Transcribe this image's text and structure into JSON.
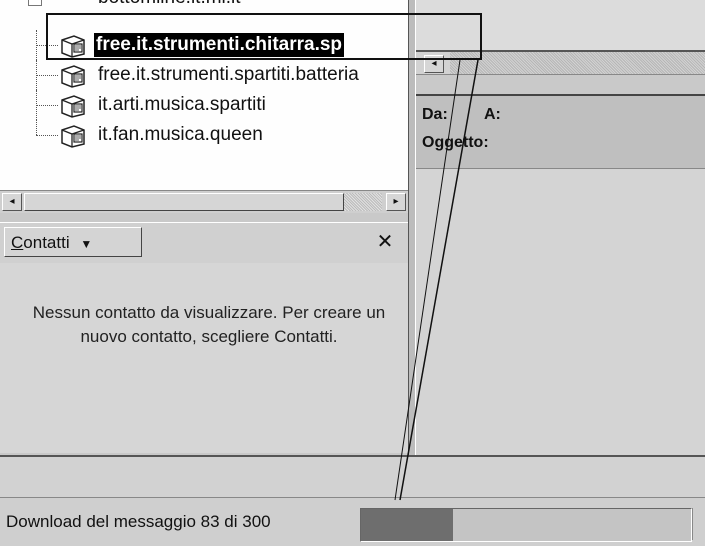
{
  "tree": {
    "items": [
      {
        "label": "free.it.strumenti.chitarra.sp",
        "selected": true
      },
      {
        "label": "free.it.strumenti.spartiti.batteria",
        "selected": false
      },
      {
        "label": "it.arti.musica.spartiti",
        "selected": false
      },
      {
        "label": "it.fan.musica.queen",
        "selected": false
      }
    ],
    "partial_label": "bottomline.it.ml.it"
  },
  "contacts": {
    "button_label_accel": "C",
    "button_label_rest": "ontatti",
    "dropdown_glyph": "▼",
    "close_glyph": "✕",
    "empty_message": "Nessun contatto da visualizzare. Per creare un nuovo contatto, scegliere Contatti."
  },
  "message_header": {
    "from_label": "Da:",
    "to_label": "A:",
    "subject_label": "Oggetto:"
  },
  "status": {
    "text": "Download del messaggio 83 di 300",
    "progress_fraction": 0.28
  },
  "scroll": {
    "left_arrow": "◂",
    "right_arrow": "▸"
  },
  "icons": {
    "newsgroup": "newsgroup-icon"
  }
}
